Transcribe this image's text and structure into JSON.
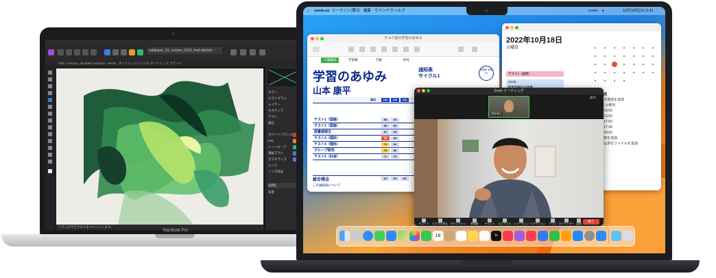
{
  "macbook_pro": {
    "label": "MacBook Pro",
    "doc_tab": "wallpaper_01_version_0019_final.afphoto",
    "context_bar": "7360 × 4912px, 36.56MP, RGBA/8 · sRGB · ダイナミックフィルタ    ダイナミック  ステージ",
    "status_text": "ドラッグでピクセルをペイントします。",
    "panel_items": [
      "カラー",
      "ヒストグラム",
      "レイヤー",
      "ネガティブ",
      "ブラシ",
      "補正",
      "ホワイトバランス",
      "HSL",
      "トーンカーブ",
      "選択ブラシ",
      "ポスタライズ",
      "レンズ",
      "ノイズ除去",
      "[画像]",
      "背景"
    ],
    "colors": {
      "swatch_red": "#d83a3a",
      "swatch_orange": "#e88a2a",
      "swatch_green": "#3cb371",
      "swatch_blue": "#3b7ddd",
      "swatch_purple": "#8a5cd6"
    }
  },
  "macbook_air": {
    "menubar": {
      "app": "zoom.us",
      "items": [
        "ミーティング",
        "表示",
        "編集",
        "ウインドウ",
        "ヘルプ"
      ],
      "right_app": "zoom",
      "clock": "10月18日(火) 9:41"
    },
    "report_window": {
      "title": "チョウ組の学習のあゆみ",
      "tabs": [
        "人事通知",
        "学習欄",
        "行動",
        "所見"
      ],
      "heading": "学習のあゆみ",
      "subtitle_1": "通知表",
      "subtitle_2": "サイクル1",
      "student_name": "山本 康平",
      "stamp_text": "校長印 担任印",
      "header_label": "満点",
      "max_scores": [
        "100",
        "100",
        "100"
      ],
      "rows": [
        {
          "subject": "テスト1（国語）",
          "s1": "86",
          "s2": "94"
        },
        {
          "subject": "テスト2（国語）",
          "s1": "90",
          "s2": "82"
        },
        {
          "subject": "読書感想文",
          "s1": "87",
          "s2": "95"
        },
        {
          "subject": "テスト3（理科）",
          "s1": "65",
          "s2": "84"
        },
        {
          "subject": "テスト4（理科）",
          "s1": "72",
          "s2": "81"
        },
        {
          "subject": "グループ研究",
          "s1": "78",
          "s2": "80"
        },
        {
          "subject": "テスト5（社会）",
          "s1": "71",
          "s2": "70"
        }
      ],
      "total_label": "総合得点",
      "total_scores": [
        "64",
        "64",
        "65"
      ],
      "notes": "この通知表について"
    },
    "calendar_window": {
      "date": "2022年10月18日",
      "weekday": "火曜日",
      "events": [
        {
          "label": "テスト1（国語）",
          "color": "#f6b6c4"
        },
        {
          "label": "13:00",
          "color": "#cfe3fb"
        },
        {
          "label": "授業参観日の準備",
          "color": "#cfe3fb"
        }
      ],
      "info": [
        "保護者面談",
        "他のビデオ通話を追加",
        "10月18日 火曜日",
        "18:30 ～ 19:00",
        "12:30 ～ 13:00",
        "16:30 ～ 17:00",
        "17:00 ～ 17:30",
        "17:30 ～ 18:00",
        "予定の通知を追加",
        "メモまたは添付ファイルを追加"
      ]
    },
    "zoom_window": {
      "title": "Zoom ミーティング",
      "self_name": "向田 裕大",
      "view_label": "表示",
      "controls": [
        "ミュート",
        "ビデオの停止",
        "セキュリティ",
        "参加者",
        "チャット",
        "画面を共有",
        "レコーディング",
        "リアクション",
        "アプリ",
        "ホワイトボード",
        "詳細"
      ],
      "end_button": "終了"
    },
    "dock_icons": [
      "finder-icon",
      "launchpad-icon",
      "safari-icon",
      "messages-icon",
      "mail-icon",
      "maps-icon",
      "photos-icon",
      "facetime-icon",
      "calendar-icon",
      "contacts-icon",
      "reminders-icon",
      "notes-icon",
      "freeform-icon",
      "tv-icon",
      "music-icon",
      "podcasts-icon",
      "news-icon",
      "keynote-icon",
      "numbers-icon",
      "pages-icon",
      "app-store-icon",
      "system-settings-icon",
      "zoom-icon",
      "downloads-icon",
      "trash-icon"
    ],
    "calendar_icon_day": "18",
    "tv_label": "tv"
  }
}
